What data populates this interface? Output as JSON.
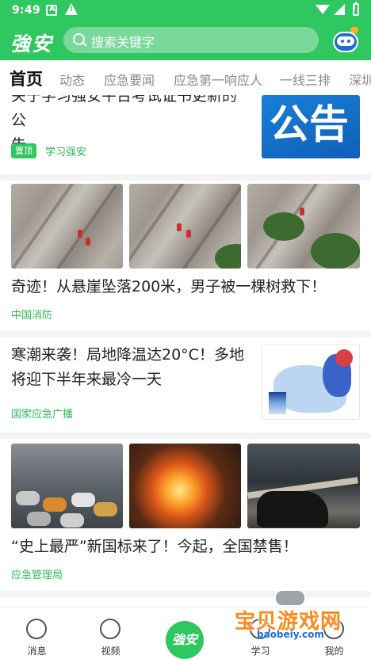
{
  "status_bar": {
    "time": "9:49",
    "icon_a": "A",
    "icon_warning": "!"
  },
  "header": {
    "logo": "強安",
    "search_placeholder": "搜索关键字",
    "accent_color": "#2fc760"
  },
  "tabs": [
    {
      "label": "首页",
      "active": true
    },
    {
      "label": "动态",
      "active": false
    },
    {
      "label": "应急要闻",
      "active": false
    },
    {
      "label": "应急第一响应人",
      "active": false
    },
    {
      "label": "一线三排",
      "active": false
    },
    {
      "label": "深圳",
      "active": false
    }
  ],
  "feed": [
    {
      "title_lines": [
        "关于学习强安平台考试证书更新的公",
        "告"
      ],
      "badge": "置顶",
      "source": "学习强安",
      "thumb_text": "公告"
    },
    {
      "title": "奇迹！从悬崖坠落200米，男子被一棵树救下！",
      "source": "中国消防"
    },
    {
      "title_lines": [
        "寒潮来袭！局地降温达20°C！多地",
        "将迎下半年来最冷一天"
      ],
      "source": "国家应急广播"
    },
    {
      "title": "“史上最严”新国标来了！今起，全国禁售！",
      "source": "应急管理局"
    }
  ],
  "bottom_nav": [
    {
      "label": "消息",
      "icon": "chat-icon"
    },
    {
      "label": "视频",
      "icon": "play-icon"
    },
    {
      "label": "強安",
      "icon": "home-center-icon"
    },
    {
      "label": "学习",
      "icon": "study-icon"
    },
    {
      "label": "我的",
      "icon": "user-icon"
    }
  ],
  "watermark": {
    "title": "宝贝游戏网",
    "url": "baobeiy.com"
  }
}
